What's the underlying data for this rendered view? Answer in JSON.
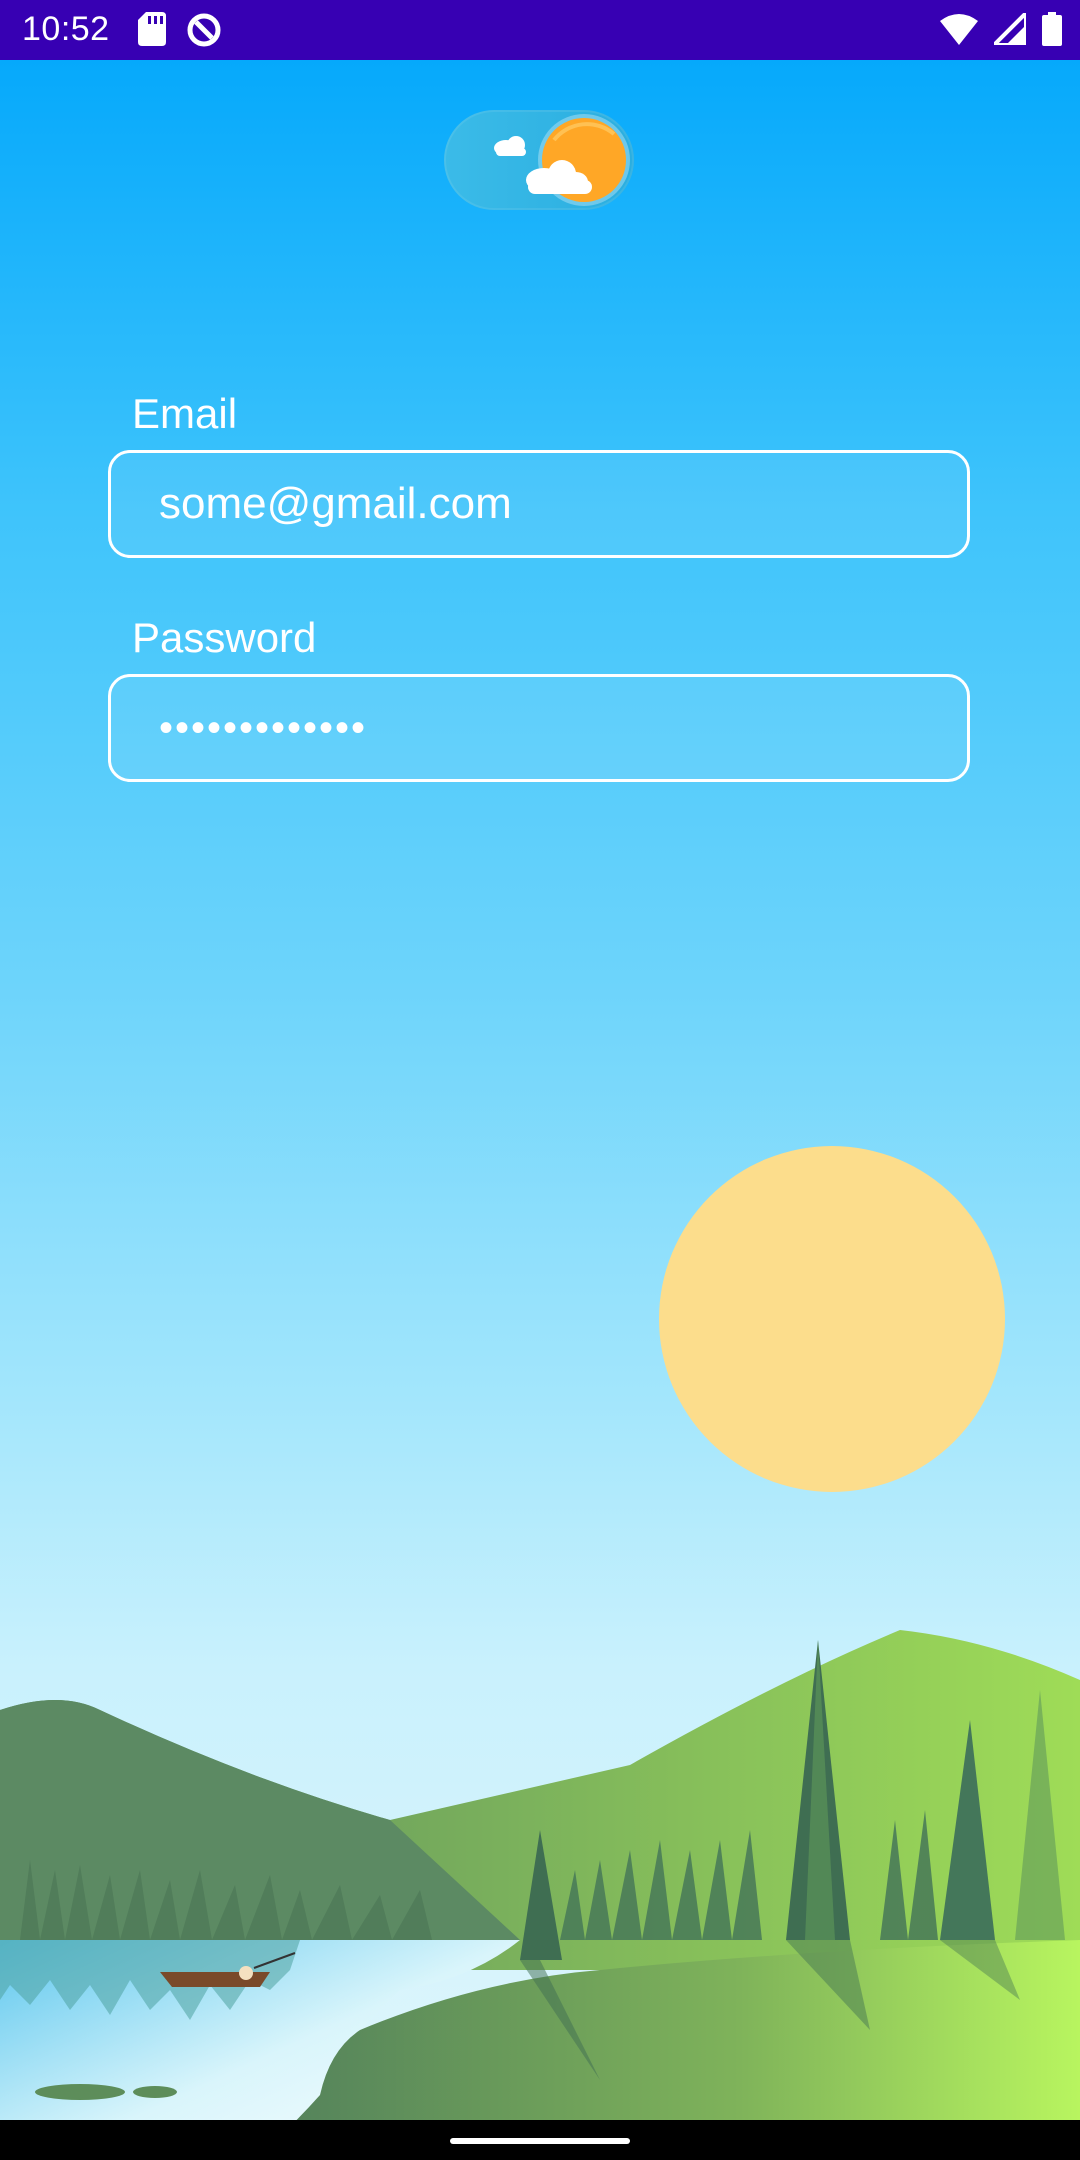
{
  "status_bar": {
    "time": "10:52",
    "left_icons": [
      "sd-card-icon",
      "data-saver-icon"
    ],
    "right_icons": [
      "wifi-icon",
      "cellular-signal-icon",
      "battery-icon"
    ],
    "background": "#3700b3"
  },
  "theme_toggle": {
    "state": "day",
    "icons": [
      "cloud-icon",
      "sun-icon"
    ]
  },
  "form": {
    "email": {
      "label": "Email",
      "value": "some@gmail.com"
    },
    "password": {
      "label": "Password",
      "value": "•••••••••••••"
    }
  },
  "colors": {
    "sky_top": "#06a9fb",
    "sky_bottom": "#dff6fb",
    "sun": "#fcdd8c",
    "toggle_sun": "#ffa726",
    "hills_light": "#b6f35f",
    "hills_dark": "#4e7a5a"
  }
}
